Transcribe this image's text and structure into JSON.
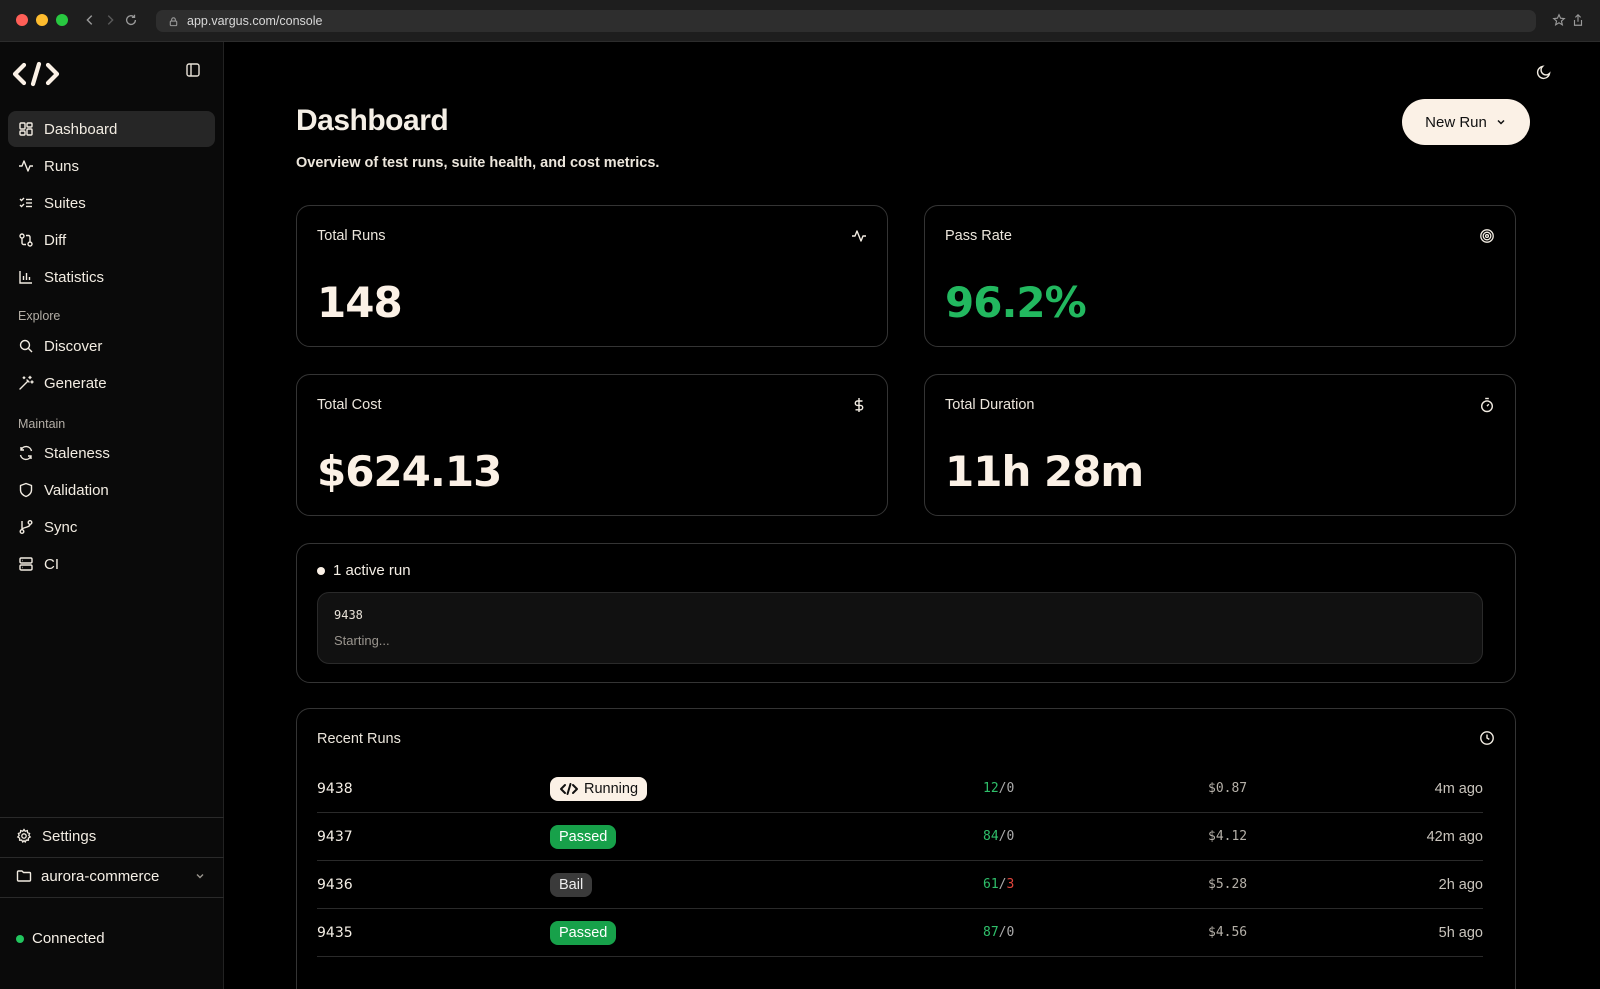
{
  "browser": {
    "url": "app.vargus.com/console"
  },
  "sidebar": {
    "items": [
      {
        "label": "Dashboard",
        "icon": "dashboard-icon"
      },
      {
        "label": "Runs",
        "icon": "activity-icon"
      },
      {
        "label": "Suites",
        "icon": "list-checks-icon"
      },
      {
        "label": "Diff",
        "icon": "git-compare-icon"
      },
      {
        "label": "Statistics",
        "icon": "bar-chart-icon"
      }
    ],
    "explore_label": "Explore",
    "explore_items": [
      {
        "label": "Discover",
        "icon": "search-icon"
      },
      {
        "label": "Generate",
        "icon": "wand-icon"
      }
    ],
    "maintain_label": "Maintain",
    "maintain_items": [
      {
        "label": "Staleness",
        "icon": "refresh-icon"
      },
      {
        "label": "Validation",
        "icon": "shield-icon"
      },
      {
        "label": "Sync",
        "icon": "git-branch-icon"
      },
      {
        "label": "CI",
        "icon": "server-icon"
      }
    ],
    "settings_label": "Settings",
    "project": "aurora-commerce",
    "status": "Connected"
  },
  "header": {
    "title": "Dashboard",
    "subtitle": "Overview of test runs, suite health, and cost metrics.",
    "new_run_label": "New Run"
  },
  "stats": [
    {
      "label": "Total Runs",
      "value": "148",
      "icon": "activity-icon"
    },
    {
      "label": "Pass Rate",
      "value": "96.2%",
      "icon": "target-icon"
    },
    {
      "label": "Total Cost",
      "value": "$624.13",
      "icon": "dollar-icon"
    },
    {
      "label": "Total Duration",
      "value": "11h 28m",
      "icon": "timer-icon"
    }
  ],
  "active": {
    "heading": "1 active run",
    "run_id": "9438",
    "status": "Starting..."
  },
  "recent": {
    "title": "Recent Runs",
    "rows": [
      {
        "id": "9438",
        "status": "Running",
        "passed": "12",
        "failed": "0",
        "cost": "$0.87",
        "time": "4m ago"
      },
      {
        "id": "9437",
        "status": "Passed",
        "passed": "84",
        "failed": "0",
        "cost": "$4.12",
        "time": "42m ago"
      },
      {
        "id": "9436",
        "status": "Bail",
        "passed": "61",
        "failed": "3",
        "cost": "$5.28",
        "time": "2h ago"
      },
      {
        "id": "9435",
        "status": "Passed",
        "passed": "87",
        "failed": "0",
        "cost": "$4.56",
        "time": "5h ago"
      }
    ]
  },
  "colors": {
    "accent_cream": "#fbf1e6",
    "success_green": "#22b85f",
    "fail_red": "#e0453c"
  }
}
